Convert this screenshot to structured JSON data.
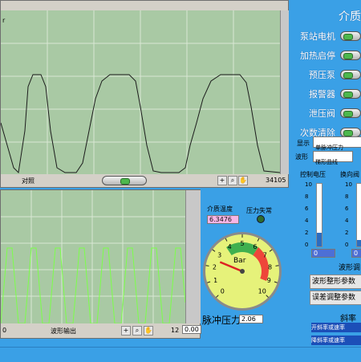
{
  "top_graph": {
    "y_label": "r",
    "legend_label": "对照",
    "x_end": "34105"
  },
  "bottom_graph": {
    "legend_label": "波形输出",
    "x_start": "0",
    "x_end": "12",
    "value_box": "0.00"
  },
  "medium_temp": {
    "label": "介质温度",
    "value": "6.3476"
  },
  "pressure_alarm": {
    "label": "压力失常"
  },
  "gauge": {
    "unit": "Bar",
    "value": 2.5,
    "scale": [
      "0",
      "1",
      "2",
      "3",
      "4",
      "5",
      "6",
      "7",
      "8",
      "9",
      "10"
    ],
    "label": "脉冲压力",
    "reading": "2.06"
  },
  "right_panel": {
    "title": "介质",
    "switches": [
      {
        "label": "泵站电机"
      },
      {
        "label": "加热启停"
      },
      {
        "label": "预压泵"
      },
      {
        "label": "报警器"
      },
      {
        "label": "泄压阀"
      },
      {
        "label": "次数清除"
      }
    ],
    "display_label": "显示",
    "display_value": "单脉冲压力",
    "waveform_label": "波形",
    "waveform_value": "梯形曲线",
    "control_voltage": {
      "label": "控制电压",
      "ticks": [
        "10",
        "8",
        "6",
        "4",
        "2",
        "0"
      ],
      "value_fraction": 0.22,
      "field": "0"
    },
    "reversing_valve": {
      "label": "换向阀",
      "ticks": [
        "10",
        "8",
        "6",
        "4",
        "2",
        "0"
      ],
      "value_fraction": 0.1,
      "field": "0"
    },
    "waveform_adjust_label": "波形调",
    "shaping_param": "波形整形参数",
    "error_param": "误差调整参数",
    "slope_title": "斜率",
    "slope_up": "开斜率或速率",
    "slope_down": "降斜率或速率"
  },
  "colors": {
    "background": "#3aa0e6",
    "plot_bg": "#a9c9a4",
    "top_trace": "#1c1c1c",
    "bottom_trace": "#7cff4a",
    "gauge_face": "#e6f27a"
  }
}
